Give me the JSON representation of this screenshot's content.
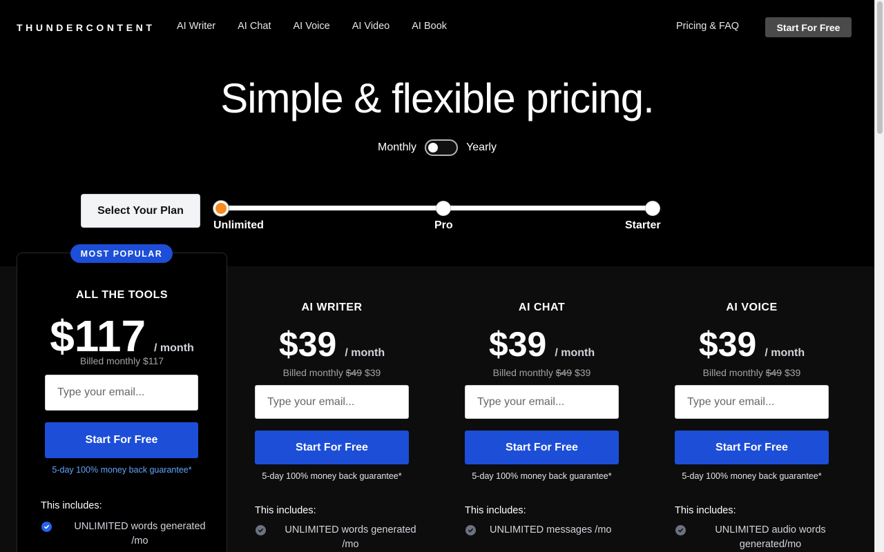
{
  "nav": {
    "logo": "THUNDERCONTENT",
    "links": [
      "AI Writer",
      "AI Chat",
      "AI Voice",
      "AI Video",
      "AI Book"
    ],
    "pricing": "Pricing & FAQ",
    "cta": "Start For Free"
  },
  "hero": {
    "title": "Simple & flexible pricing.",
    "monthly": "Monthly",
    "yearly": "Yearly"
  },
  "plan_selector": {
    "button": "Select Your Plan",
    "options": [
      "Unlimited",
      "Pro",
      "Starter"
    ],
    "selected": "Unlimited"
  },
  "badge": "MOST POPULAR",
  "cards": [
    {
      "name": "ALL THE TOOLS",
      "price": "$117",
      "per": "/ month",
      "billed": "Billed monthly $117",
      "billed_old": "",
      "billed_new": "",
      "email_placeholder": "Type your email...",
      "cta": "Start For Free",
      "guarantee": "5-day 100% money back guarantee*",
      "includes": "This includes:",
      "features": [
        "UNLIMITED words generated /mo"
      ]
    },
    {
      "name": "AI WRITER",
      "price": "$39",
      "per": "/ month",
      "billed": "Billed monthly ",
      "billed_old": "$49",
      "billed_new": " $39",
      "email_placeholder": "Type your email...",
      "cta": "Start For Free",
      "guarantee": "5-day 100% money back guarantee*",
      "includes": "This includes:",
      "features": [
        "UNLIMITED words generated /mo"
      ]
    },
    {
      "name": "AI CHAT",
      "price": "$39",
      "per": "/ month",
      "billed": "Billed monthly ",
      "billed_old": "$49",
      "billed_new": " $39",
      "email_placeholder": "Type your email...",
      "cta": "Start For Free",
      "guarantee": "5-day 100% money back guarantee*",
      "includes": "This includes:",
      "features": [
        "UNLIMITED messages /mo"
      ]
    },
    {
      "name": "AI VOICE",
      "price": "$39",
      "per": "/ month",
      "billed": "Billed monthly ",
      "billed_old": "$49",
      "billed_new": " $39",
      "email_placeholder": "Type your email...",
      "cta": "Start For Free",
      "guarantee": "5-day 100% money back guarantee*",
      "includes": "This includes:",
      "features": [
        "UNLIMITED audio words generated/mo"
      ]
    }
  ],
  "icons": {
    "check": "check-circle-icon",
    "toggle": "toggle-switch"
  },
  "colors": {
    "accent": "#1d4ed8",
    "slider_active": "#f6891f",
    "background": "#000000"
  }
}
